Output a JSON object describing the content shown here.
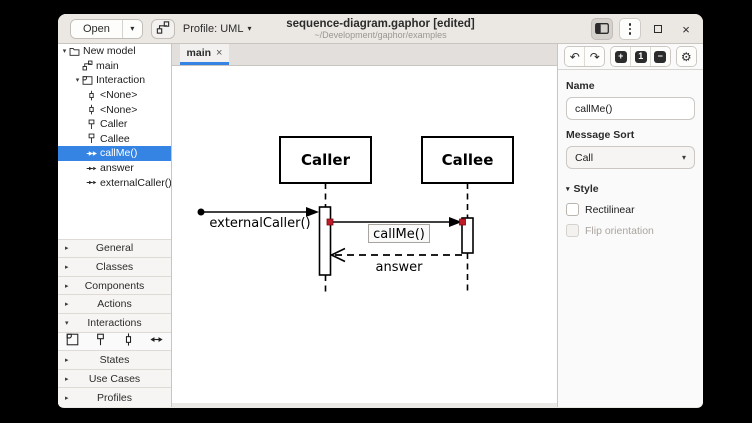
{
  "colors": {
    "accent": "#3584e4",
    "handle_red": "#c01c28",
    "selection_bg": "#3584e4"
  },
  "icons": {
    "caret_down": "▾",
    "expander_open": "▾",
    "expander_closed": "▸",
    "close": "×",
    "undo": "↶",
    "redo": "↷",
    "zoom_in": "+",
    "zoom_original": "1",
    "zoom_out": "−",
    "gear": "⚙"
  },
  "header": {
    "open_label": "Open",
    "profile_label": "Profile: UML",
    "title": "sequence-diagram.gaphor [edited]",
    "subtitle": "~/Development/gaphor/examples"
  },
  "tree": {
    "items": [
      {
        "label": "New model",
        "icon": "folder",
        "depth": 0,
        "expanded": true
      },
      {
        "label": "main",
        "icon": "diagram",
        "depth": 1
      },
      {
        "label": "Interaction",
        "icon": "interaction",
        "depth": 1,
        "expanded": true
      },
      {
        "label": "<None>",
        "icon": "execution-specification",
        "depth": 2
      },
      {
        "label": "<None>",
        "icon": "execution-specification",
        "depth": 2
      },
      {
        "label": "Caller",
        "icon": "lifeline",
        "depth": 2
      },
      {
        "label": "Callee",
        "icon": "lifeline",
        "depth": 2
      },
      {
        "label": "callMe()",
        "icon": "message",
        "depth": 2,
        "selected": true
      },
      {
        "label": "answer",
        "icon": "message",
        "depth": 2
      },
      {
        "label": "externalCaller()",
        "icon": "message",
        "depth": 2
      }
    ]
  },
  "toolbox": {
    "sections": [
      {
        "label": "General",
        "expanded": false
      },
      {
        "label": "Classes",
        "expanded": false
      },
      {
        "label": "Components",
        "expanded": false
      },
      {
        "label": "Actions",
        "expanded": false
      },
      {
        "label": "Interactions",
        "expanded": true
      },
      {
        "label": "States",
        "expanded": false
      },
      {
        "label": "Use Cases",
        "expanded": false
      },
      {
        "label": "Profiles",
        "expanded": false
      }
    ],
    "interaction_tools": [
      "interaction",
      "lifeline",
      "execution-specification",
      "message"
    ]
  },
  "tabs": [
    {
      "label": "main"
    }
  ],
  "diagram": {
    "lifelines": [
      {
        "name": "Caller"
      },
      {
        "name": "Callee"
      }
    ],
    "messages": [
      {
        "name": "externalCaller()",
        "type": "found-message",
        "to": "Caller"
      },
      {
        "name": "callMe()",
        "type": "call",
        "from": "Caller",
        "to": "Callee",
        "selected": true
      },
      {
        "name": "answer",
        "type": "return",
        "from": "Callee",
        "to": "Caller"
      }
    ]
  },
  "properties": {
    "name_label": "Name",
    "name_value": "callMe()",
    "message_sort_label": "Message Sort",
    "message_sort_value": "Call",
    "style_label": "Style",
    "options": [
      {
        "label": "Rectilinear",
        "checked": false,
        "enabled": true
      },
      {
        "label": "Flip orientation",
        "checked": false,
        "enabled": false
      }
    ]
  }
}
